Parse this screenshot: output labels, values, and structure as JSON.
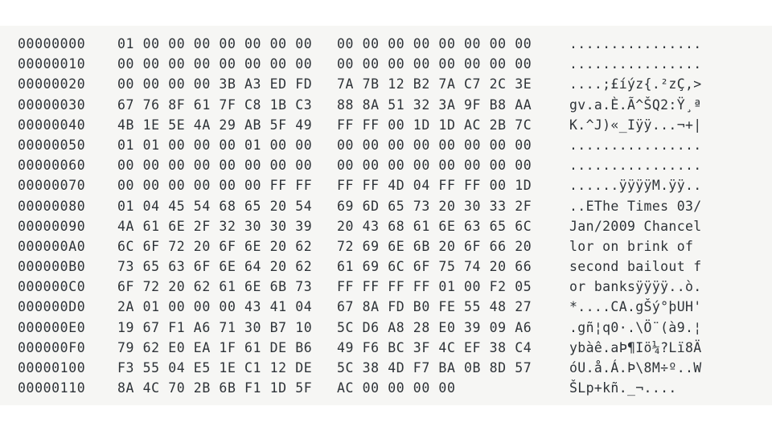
{
  "view": {
    "title": "hex-dump",
    "background_color": "#ffffff",
    "pane_color": "#f6f6f4",
    "text_color": "#2e3338",
    "bytes_per_row": 16,
    "group_size": 8
  },
  "rows": [
    {
      "offset": "00000000",
      "hex_left": "01 00 00 00 00 00 00 00",
      "hex_right": "00 00 00 00 00 00 00 00",
      "ascii": "................"
    },
    {
      "offset": "00000010",
      "hex_left": "00 00 00 00 00 00 00 00",
      "hex_right": "00 00 00 00 00 00 00 00",
      "ascii": "................"
    },
    {
      "offset": "00000020",
      "hex_left": "00 00 00 00 3B A3 ED FD",
      "hex_right": "7A 7B 12 B2 7A C7 2C 3E",
      "ascii": "....;£íýz{.²zÇ,>"
    },
    {
      "offset": "00000030",
      "hex_left": "67 76 8F 61 7F C8 1B C3",
      "hex_right": "88 8A 51 32 3A 9F B8 AA",
      "ascii": "gv.a.È.Ã^ŠQ2:Ÿ¸ª"
    },
    {
      "offset": "00000040",
      "hex_left": "4B 1E 5E 4A 29 AB 5F 49",
      "hex_right": "FF FF 00 1D 1D AC 2B 7C",
      "ascii": "K.^J)«_Iÿÿ...¬+|"
    },
    {
      "offset": "00000050",
      "hex_left": "01 01 00 00 00 01 00 00",
      "hex_right": "00 00 00 00 00 00 00 00",
      "ascii": "................"
    },
    {
      "offset": "00000060",
      "hex_left": "00 00 00 00 00 00 00 00",
      "hex_right": "00 00 00 00 00 00 00 00",
      "ascii": "................"
    },
    {
      "offset": "00000070",
      "hex_left": "00 00 00 00 00 00 FF FF",
      "hex_right": "FF FF 4D 04 FF FF 00 1D",
      "ascii": "......ÿÿÿÿM.ÿÿ.."
    },
    {
      "offset": "00000080",
      "hex_left": "01 04 45 54 68 65 20 54",
      "hex_right": "69 6D 65 73 20 30 33 2F",
      "ascii": "..EThe Times 03/"
    },
    {
      "offset": "00000090",
      "hex_left": "4A 61 6E 2F 32 30 30 39",
      "hex_right": "20 43 68 61 6E 63 65 6C",
      "ascii": "Jan/2009 Chancel"
    },
    {
      "offset": "000000A0",
      "hex_left": "6C 6F 72 20 6F 6E 20 62",
      "hex_right": "72 69 6E 6B 20 6F 66 20",
      "ascii": "lor on brink of "
    },
    {
      "offset": "000000B0",
      "hex_left": "73 65 63 6F 6E 64 20 62",
      "hex_right": "61 69 6C 6F 75 74 20 66",
      "ascii": "second bailout f"
    },
    {
      "offset": "000000C0",
      "hex_left": "6F 72 20 62 61 6E 6B 73",
      "hex_right": "FF FF FF FF 01 00 F2 05",
      "ascii": "or banksÿÿÿÿ..ò."
    },
    {
      "offset": "000000D0",
      "hex_left": "2A 01 00 00 00 43 41 04",
      "hex_right": "67 8A FD B0 FE 55 48 27",
      "ascii": "*....CA.gŠý°þUH'"
    },
    {
      "offset": "000000E0",
      "hex_left": "19 67 F1 A6 71 30 B7 10",
      "hex_right": "5C D6 A8 28 E0 39 09 A6",
      "ascii": ".gñ¦q0·.\\Ö¨(à9.¦"
    },
    {
      "offset": "000000F0",
      "hex_left": "79 62 E0 EA 1F 61 DE B6",
      "hex_right": "49 F6 BC 3F 4C EF 38 C4",
      "ascii": "ybàê.aÞ¶Iö¼?Lï8Ä"
    },
    {
      "offset": "00000100",
      "hex_left": "F3 55 04 E5 1E C1 12 DE",
      "hex_right": "5C 38 4D F7 BA 0B 8D 57",
      "ascii": "óU.å.Á.Þ\\8M÷º..W"
    },
    {
      "offset": "00000110",
      "hex_left": "8A 4C 70 2B 6B F1 1D 5F",
      "hex_right": "AC 00 00 00 00",
      "ascii": "ŠLp+kñ._¬...."
    }
  ]
}
